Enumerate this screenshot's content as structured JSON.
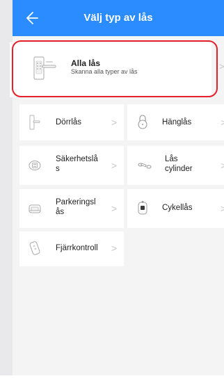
{
  "header": {
    "title": "Välj typ av lås",
    "back_icon": "arrow-left-icon",
    "color": "#2b8cff"
  },
  "all_locks": {
    "title": "Alla lås",
    "subtitle": "Skanna alla typer av lås",
    "chevron": ">",
    "highlight_color": "#e5202b"
  },
  "types": [
    {
      "label": "Dörrlås",
      "chevron": ">",
      "icon": "door-lock-icon"
    },
    {
      "label": "Hänglås",
      "chevron": ">",
      "icon": "padlock-icon"
    },
    {
      "label_line1": "Säkerhetslå",
      "label_line2": "s",
      "chevron": ">",
      "icon": "safe-icon"
    },
    {
      "label_line1": "Lås",
      "label_line2": "cylinder",
      "chevron": ">",
      "icon": "lock-cylinder-icon"
    },
    {
      "label_line1": "Parkeringsl",
      "label_line2": "ås",
      "chevron": ">",
      "icon": "parking-lock-icon"
    },
    {
      "label": "Cykellås",
      "chevron": ">",
      "icon": "bike-lock-icon"
    },
    {
      "label": "Fjärrkontroll",
      "chevron": ">",
      "icon": "remote-control-icon"
    }
  ]
}
